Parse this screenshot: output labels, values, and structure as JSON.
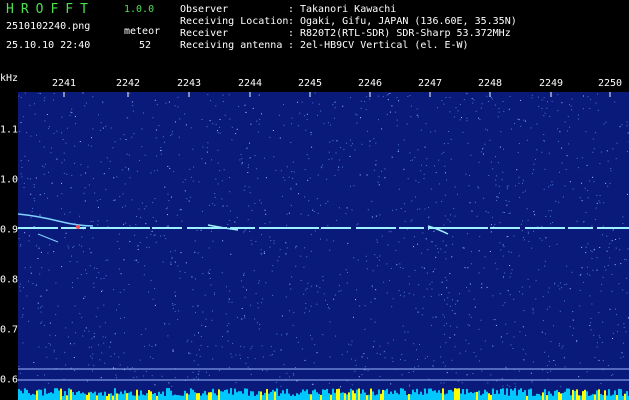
{
  "header": {
    "app_title": "HROFFT",
    "app_version": "1.0.0",
    "file_name": "2510102240.png",
    "datetime": "25.10.10 22:40",
    "meteor_label": "meteor",
    "meteor_count": "52"
  },
  "info": [
    {
      "key": "Observer",
      "sep": ":",
      "value": "Takanori Kawachi"
    },
    {
      "key": "Receiving Location",
      "sep": ":",
      "value": "Ogaki, Gifu, JAPAN (136.60E, 35.35N)"
    },
    {
      "key": "Receiver",
      "sep": ":",
      "value": "R820T2(RTL-SDR) SDR-Sharp 53.372MHz"
    },
    {
      "key": "Receiving antenna",
      "sep": ":",
      "value": "2el-HB9CV Vertical (el. E-W)"
    }
  ],
  "axes": {
    "unit_label": "kHz",
    "time_ticks": [
      "2241",
      "2242",
      "2243",
      "2244",
      "2245",
      "2246",
      "2247",
      "2248",
      "2249",
      "2250"
    ],
    "freq_ticks": [
      "1.1",
      "1.0",
      "0.9",
      "0.8",
      "0.7",
      "0.6"
    ]
  },
  "colors": {
    "background": "#0a1a7a",
    "noise": "#4a7ad8",
    "carrier": "#9ef0ff",
    "echo_head": "#ff5050",
    "bottom_bar": "#00c8ff",
    "peak": "#ffff00",
    "title_green": "#4de04d"
  }
}
